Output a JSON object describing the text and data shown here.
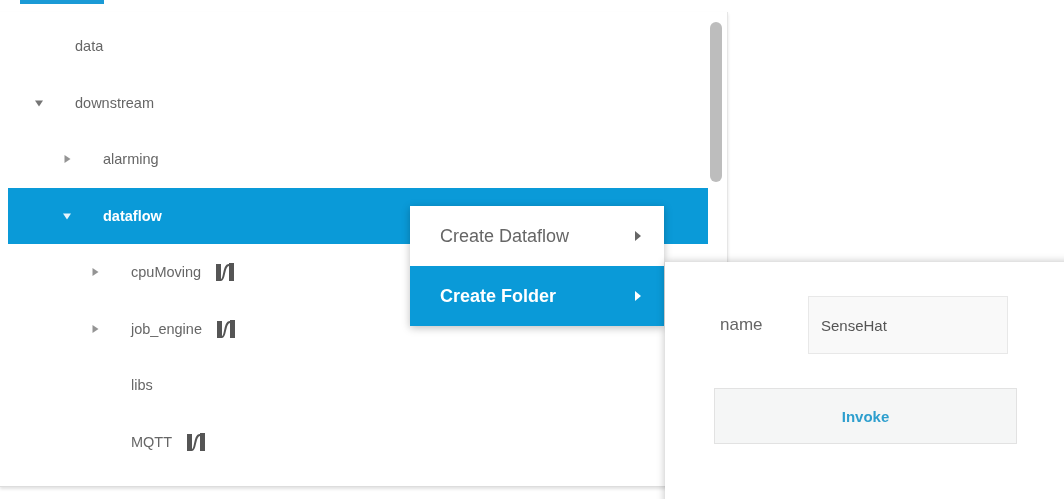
{
  "tree": [
    {
      "label": "data",
      "kind": "leaf",
      "selected": false,
      "flow_icon": false
    },
    {
      "label": "downstream",
      "kind": "folder",
      "expanded": true,
      "selected": false,
      "flow_icon": false,
      "children": [
        {
          "label": "alarming",
          "kind": "folder",
          "expanded": false,
          "selected": false,
          "flow_icon": false
        },
        {
          "label": "dataflow",
          "kind": "folder",
          "expanded": true,
          "selected": true,
          "flow_icon": false,
          "children": [
            {
              "label": "cpuMoving",
              "kind": "folder",
              "expanded": false,
              "selected": false,
              "flow_icon": true
            },
            {
              "label": "job_engine",
              "kind": "folder",
              "expanded": false,
              "selected": false,
              "flow_icon": true
            },
            {
              "label": "libs",
              "kind": "leaf",
              "selected": false,
              "flow_icon": false
            },
            {
              "label": "MQTT",
              "kind": "leaf",
              "selected": false,
              "flow_icon": true
            }
          ]
        }
      ]
    }
  ],
  "context_menu": {
    "items": [
      {
        "label": "Create Dataflow",
        "selected": false
      },
      {
        "label": "Create Folder",
        "selected": true
      }
    ]
  },
  "submenu": {
    "field_label": "name",
    "field_value": "SenseHat",
    "button": "Invoke"
  }
}
